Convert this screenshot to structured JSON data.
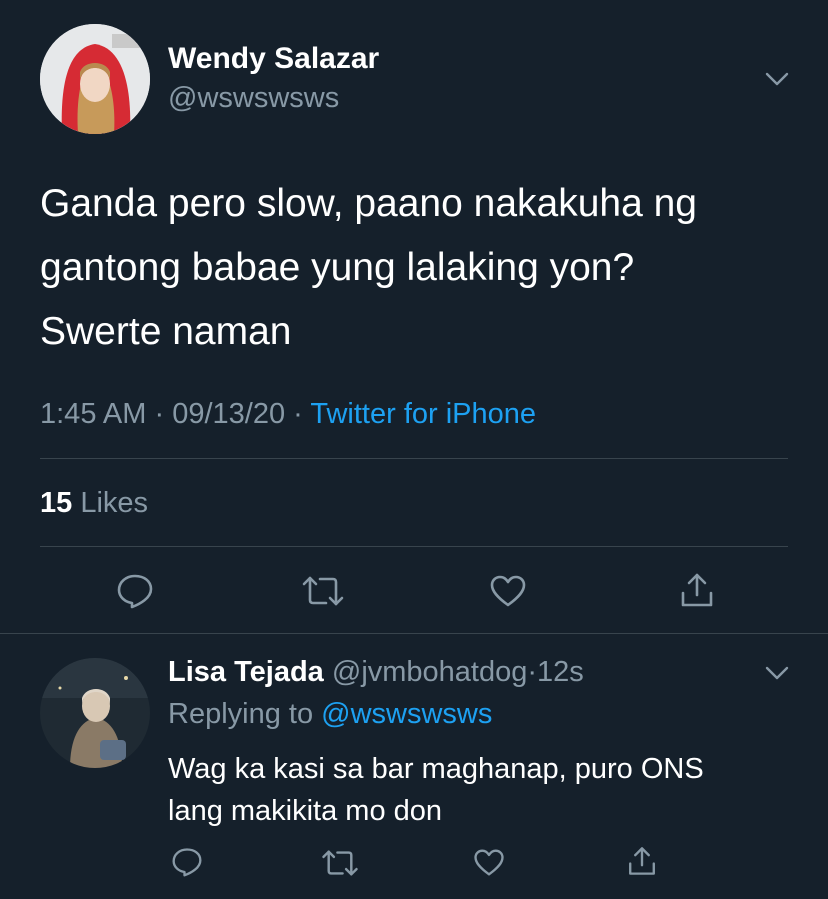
{
  "tweet": {
    "author_name": "Wendy Salazar",
    "author_handle": "@wswswsws",
    "text_line1": "Ganda pero slow, paano nakakuha ng",
    "text_line2": "gantong babae yung lalaking yon?",
    "text_line3": "Swerte naman",
    "time": "1:45 AM",
    "date": "09/13/20",
    "separator": "·",
    "source": "Twitter for iPhone",
    "likes_count": "15",
    "likes_label": "Likes"
  },
  "reply": {
    "author_name": "Lisa Tejada",
    "author_handle": "@jvmbohatdog",
    "separator": "·",
    "time_ago": "12s",
    "replying_to_label": "Replying to",
    "replying_to_handle": "@wswswsws",
    "text_line1": "Wag ka kasi sa bar maghanap, puro ONS",
    "text_line2": "lang makikita mo don"
  },
  "icons": {
    "reply": "comment-icon",
    "retweet": "retweet-icon",
    "like": "heart-icon",
    "share": "share-icon",
    "menu": "chevron-down-icon"
  },
  "colors": {
    "background": "#15202b",
    "text": "#ffffff",
    "muted": "#8899a6",
    "link": "#1da1f2",
    "divider": "#38444d"
  }
}
